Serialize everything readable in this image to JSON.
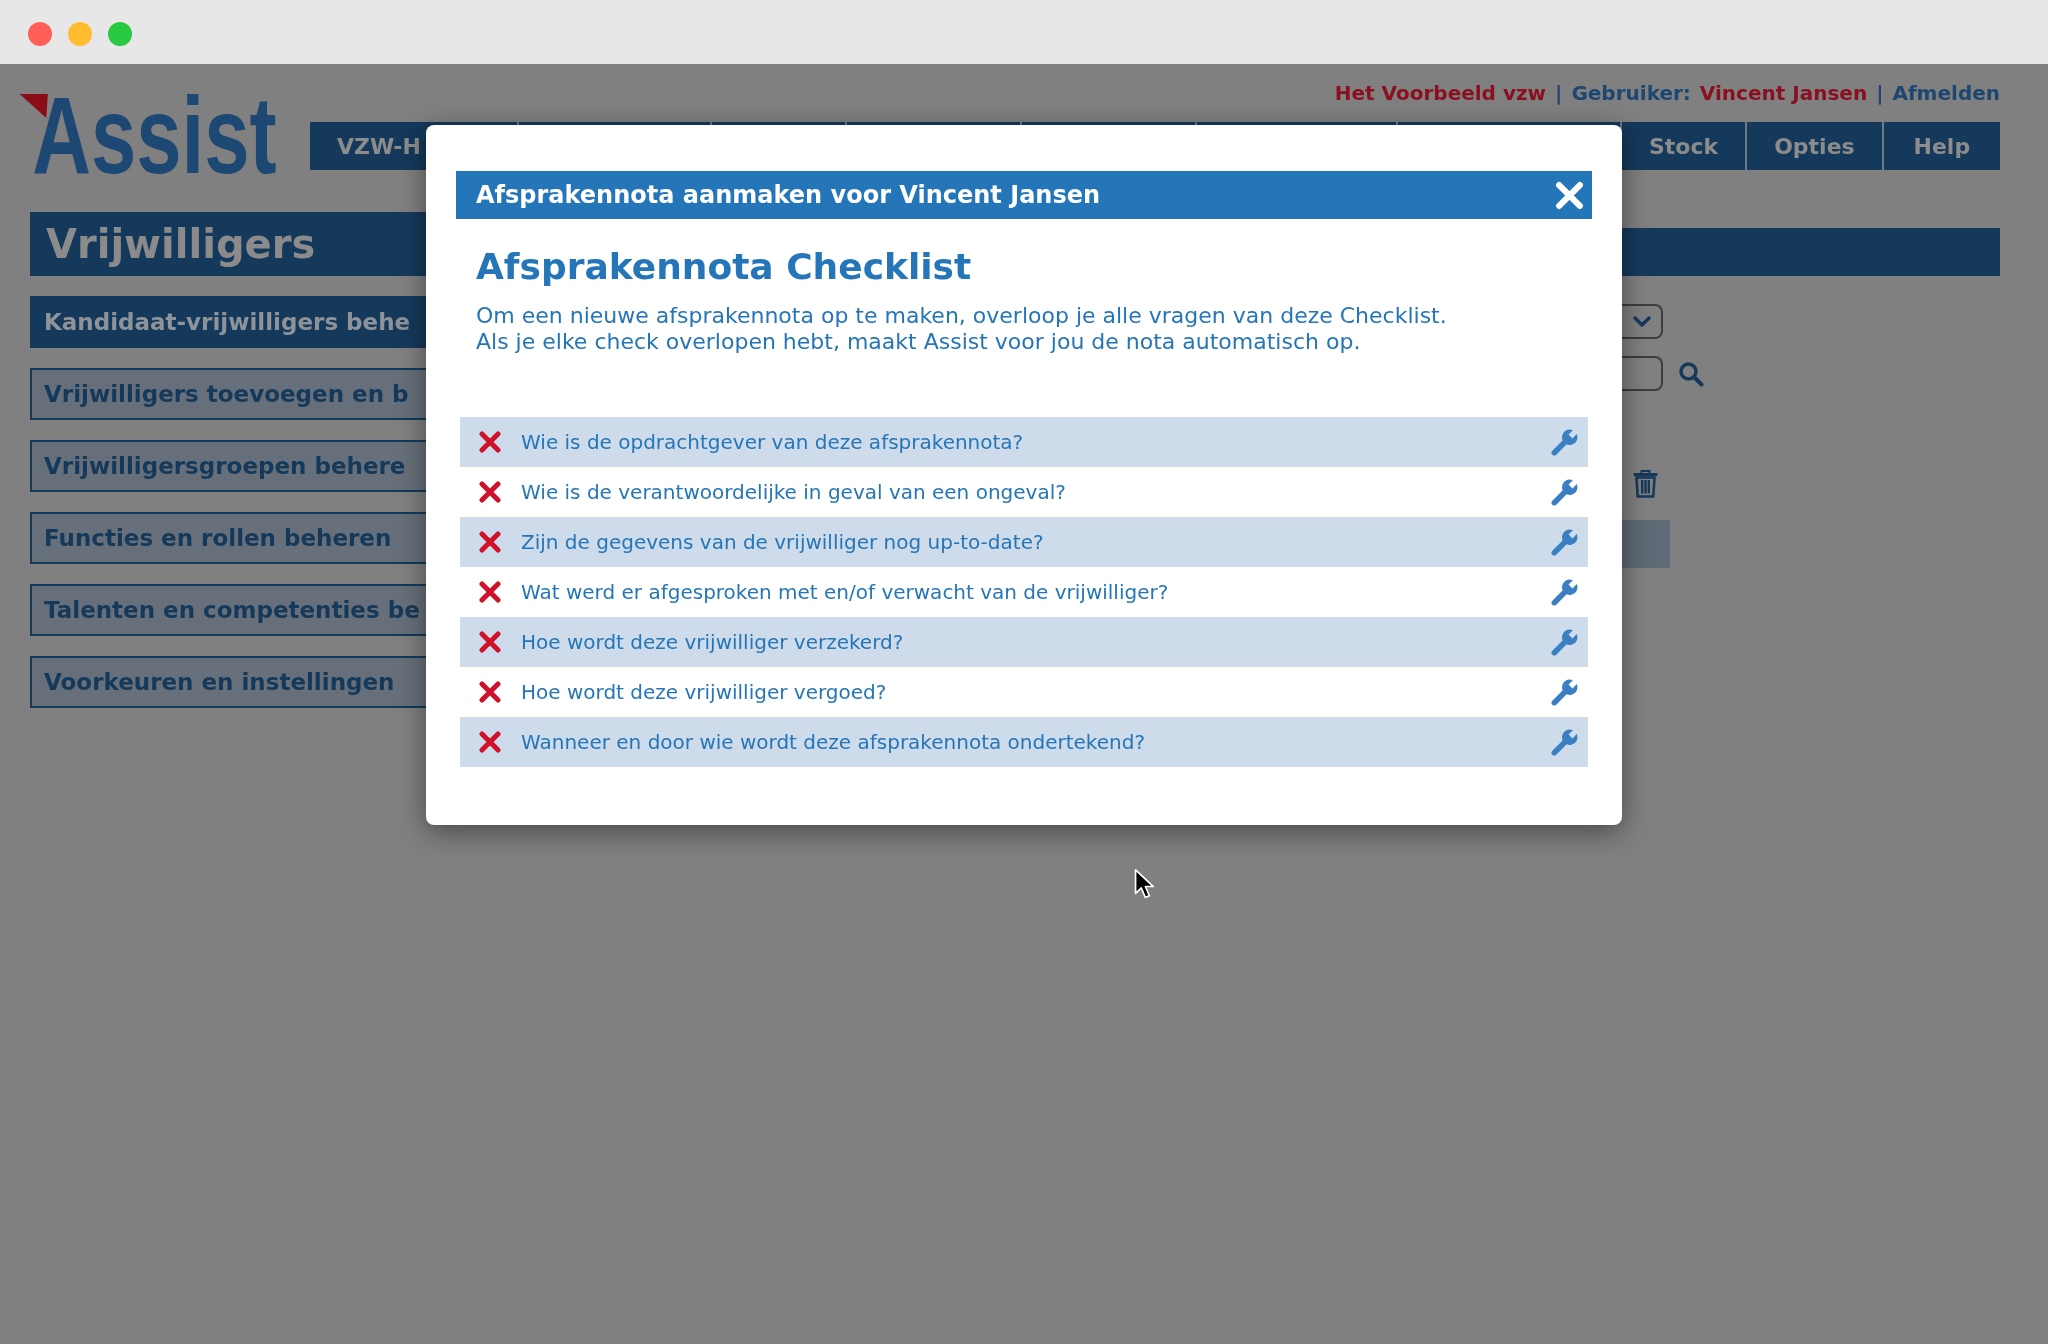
{
  "window": {
    "controls": [
      {
        "color": "#ff5f57"
      },
      {
        "color": "#febc2e"
      },
      {
        "color": "#28c840"
      }
    ]
  },
  "header": {
    "logo": "Assist",
    "account_bar": [
      {
        "kind": "value",
        "text": "Het Voorbeeld vzw"
      },
      {
        "kind": "separator",
        "text": "|"
      },
      {
        "kind": "label",
        "text": "Gebruiker:"
      },
      {
        "kind": "value",
        "text": "Vincent Jansen"
      },
      {
        "kind": "separator",
        "text": "|"
      },
      {
        "kind": "link",
        "text": "Afmelden"
      }
    ],
    "nav": [
      {
        "label": "VZW-H",
        "selected": false
      },
      {
        "label": "Stock",
        "selected": false
      },
      {
        "label": "Opties",
        "selected": false
      },
      {
        "label": "Help",
        "selected": false
      }
    ]
  },
  "page_title": "Vrijwilligers",
  "sidebar": {
    "items": [
      {
        "label": "Kandidaat-vrijwilligers behe",
        "selected": true
      },
      {
        "label": "Vrijwilligers toevoegen en b",
        "selected": false
      },
      {
        "label": "Vrijwilligersgroepen behere",
        "selected": false
      },
      {
        "label": "Functies en rollen beheren",
        "selected": false
      },
      {
        "label": "Talenten en competenties be",
        "selected": false
      },
      {
        "label": "Voorkeuren en instellingen",
        "selected": false
      }
    ]
  },
  "dialog": {
    "header_title": "Afsprakennota aanmaken voor Vincent Jansen",
    "title": "Afsprakennota Checklist",
    "intro_lines": [
      "Om een nieuwe afsprakennota op te maken, overloop je alle vragen van deze Checklist.",
      "Als je elke check overlopen hebt, maakt Assist voor jou de nota automatisch op."
    ],
    "items": [
      {
        "question": "Wie is de opdrachtgever van deze afsprakennota?",
        "checked": false
      },
      {
        "question": "Wie is de verantwoordelijke in geval van een ongeval?",
        "checked": false
      },
      {
        "question": "Zijn de gegevens van de vrijwilliger nog up-to-date?",
        "checked": false
      },
      {
        "question": "Wat werd er afgesproken met en/of verwacht van de vrijwilliger?",
        "checked": false
      },
      {
        "question": "Hoe wordt deze vrijwilliger verzekerd?",
        "checked": false
      },
      {
        "question": "Hoe wordt deze vrijwilliger vergoed?",
        "checked": false
      },
      {
        "question": "Wanneer en door wie wordt deze afsprakennota ondertekend?",
        "checked": false
      }
    ]
  }
}
